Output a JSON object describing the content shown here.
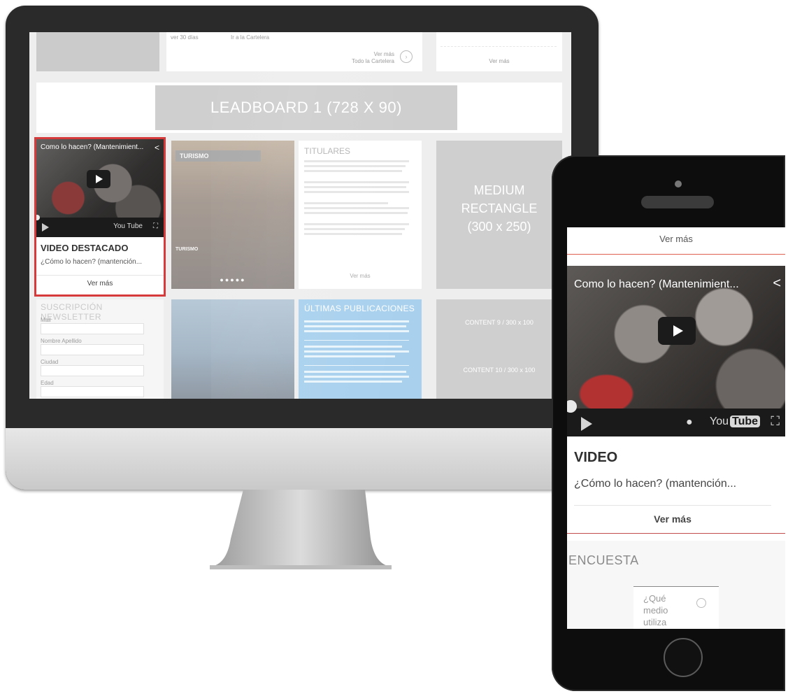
{
  "desktop": {
    "leadboard": "LEADBOARD 1 (728 X 90)",
    "top_snippets": {
      "b_left": "ver 30 días",
      "b_right": "Ir a la Cartelera",
      "c_text_1": "Ver más",
      "c_text_2": "Todo la Cartelera",
      "d_more": "Ver más"
    },
    "video_card": {
      "thumb_title": "Como lo hacen? (Mantenimient...",
      "youtube": "You Tube",
      "title": "VIDEO DESTACADO",
      "subtitle": "¿Cómo lo hacen? (mantención...",
      "more": "Ver más"
    },
    "turismo": {
      "label": "TURISMO",
      "caption": "TURISMO",
      "dots": "●●●●●"
    },
    "titulares": {
      "title": "TITULARES",
      "more": "Ver más"
    },
    "medium_rect": [
      "MEDIUM",
      "RECTANGLE",
      "(300 x 250)"
    ],
    "newsletter": {
      "title": "SUSCRIPCIÓN NEWSLETTER",
      "fields": [
        "Mail",
        "Nombre Apellido",
        "Ciudad",
        "Edad"
      ]
    },
    "ultimas": {
      "title": "ÚLTIMAS PUBLICACIONES"
    },
    "content_boxes": [
      "CONTENT 9 / 300 x 100",
      "CONTENT 10 / 300 x 100"
    ]
  },
  "phone": {
    "top_more": "Ver más",
    "video_title": "Como lo hacen? (Mantenimient...",
    "youtube_you": "You",
    "youtube_tube": "Tube",
    "section_title": "VIDEO",
    "subtitle": "¿Cómo lo hacen? (mantención...",
    "more": "Ver más",
    "poll_title": "ENCUESTA",
    "poll_question": "¿Qué medio utiliza para"
  }
}
